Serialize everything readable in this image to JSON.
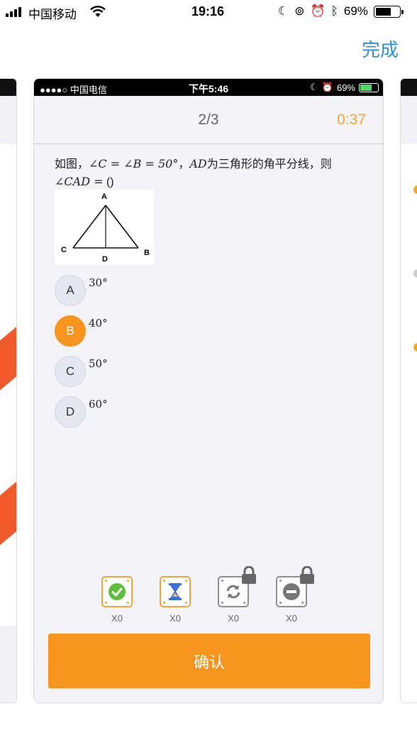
{
  "status_bar": {
    "carrier": "中国移动",
    "time": "19:16",
    "battery": "69%"
  },
  "top_bar": {
    "done_label": "完成"
  },
  "inner_status": {
    "carrier": "●●●●○ 中国电信",
    "time": "下午5:46",
    "battery": "69%"
  },
  "header": {
    "progress": "2/3",
    "timer": "0:37"
  },
  "question": {
    "prefix": "如图，",
    "condition": "∠C = ∠B = 50°",
    "sep": "，",
    "segment": "AD",
    "middle": "为三角形的角平分线，则",
    "target": "∠CAD =",
    "blank": " ()"
  },
  "figure": {
    "label_a": "A",
    "label_b": "B",
    "label_c": "C",
    "label_d": "D"
  },
  "options": [
    {
      "letter": "A",
      "value": "30°",
      "selected": false
    },
    {
      "letter": "B",
      "value": "40°",
      "selected": true
    },
    {
      "letter": "C",
      "value": "50°",
      "selected": false
    },
    {
      "letter": "D",
      "value": "60°",
      "selected": false
    }
  ],
  "tools": [
    {
      "icon": "check-icon",
      "count": "X0",
      "locked": false
    },
    {
      "icon": "hourglass-icon",
      "count": "X0",
      "locked": false
    },
    {
      "icon": "refresh-icon",
      "count": "X0",
      "locked": true
    },
    {
      "icon": "minus-icon",
      "count": "X0",
      "locked": true
    }
  ],
  "confirm_label": "确认",
  "colors": {
    "accent": "#f7941d",
    "timer": "#f5a623",
    "link": "#2f8fd8"
  }
}
